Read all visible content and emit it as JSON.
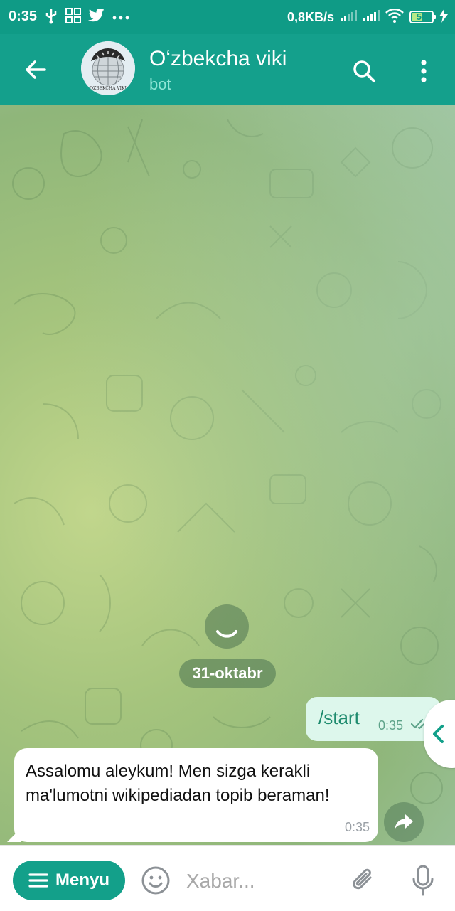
{
  "status_bar": {
    "time": "0:35",
    "net_speed": "0,8KB/s",
    "battery_level": "57",
    "left_icons": [
      "usb-icon",
      "apps-grid-icon",
      "twitter-icon",
      "more-dots-icon"
    ],
    "right_icons": [
      "signal-icon",
      "signal-icon",
      "wifi-icon",
      "battery-icon",
      "charging-icon"
    ]
  },
  "header": {
    "title": "Oʻzbekcha viki",
    "subtitle": "bot",
    "avatar_caption": "OZBEKCHA VIKI",
    "icons": [
      "back-arrow-icon",
      "search-icon",
      "more-vertical-icon"
    ]
  },
  "chat": {
    "date_separator": "31-oktabr",
    "messages": [
      {
        "direction": "out",
        "text": "/start",
        "time": "0:35",
        "status": "read"
      },
      {
        "direction": "in",
        "text": "Assalomu aleykum! Men sizga kerakli ma'lumotni wikipediadan topib beraman!",
        "time": "0:35"
      }
    ]
  },
  "input_bar": {
    "menu_label": "Menyu",
    "placeholder": "Xabar...",
    "icons": [
      "menu-lines-icon",
      "emoji-icon",
      "paperclip-icon",
      "microphone-icon"
    ]
  },
  "colors": {
    "header": "#14a08c",
    "status_bar": "#0f9b86",
    "accent": "#13a08a",
    "outgoing_bubble": "#ddf7ec",
    "incoming_bubble": "#ffffff"
  }
}
